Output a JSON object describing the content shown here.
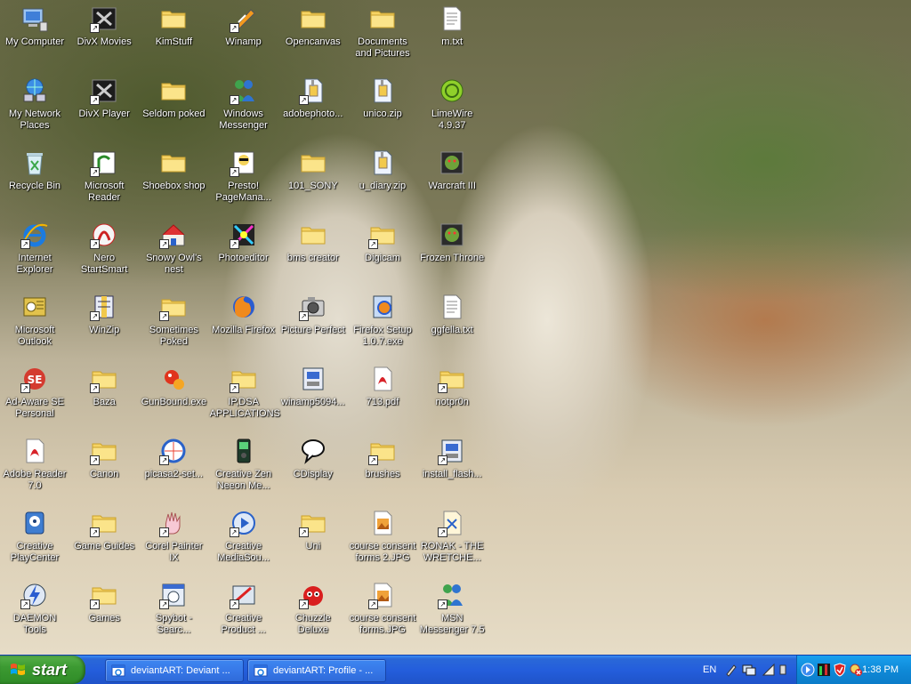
{
  "desktop": {
    "icons": [
      {
        "label": "My Computer",
        "icon": "computer-icon"
      },
      {
        "label": "DivX Movies",
        "icon": "divx-icon"
      },
      {
        "label": "KimStuff",
        "icon": "folder-icon"
      },
      {
        "label": "Winamp",
        "icon": "winamp-icon"
      },
      {
        "label": "Opencanvas",
        "icon": "folder-icon"
      },
      {
        "label": "Documents and Pictures",
        "icon": "folder-icon"
      },
      {
        "label": "m.txt",
        "icon": "text-file-icon"
      },
      {
        "label": "My Network Places",
        "icon": "network-icon"
      },
      {
        "label": "DivX Player",
        "icon": "divx-icon"
      },
      {
        "label": "Seldom poked",
        "icon": "folder-icon"
      },
      {
        "label": "Windows Messenger",
        "icon": "messenger-icon"
      },
      {
        "label": "adobephoto...",
        "icon": "zip-icon"
      },
      {
        "label": "unico.zip",
        "icon": "zip-icon"
      },
      {
        "label": "LimeWire 4.9.37",
        "icon": "limewire-icon"
      },
      {
        "label": "Recycle Bin",
        "icon": "recycle-bin-icon"
      },
      {
        "label": "Microsoft Reader",
        "icon": "reader-icon"
      },
      {
        "label": "Shoebox shop",
        "icon": "folder-icon"
      },
      {
        "label": "Presto! PageMana...",
        "icon": "presto-icon"
      },
      {
        "label": "101_SONY",
        "icon": "folder-icon"
      },
      {
        "label": "u_diary.zip",
        "icon": "zip-icon"
      },
      {
        "label": "Warcraft III",
        "icon": "warcraft-icon"
      },
      {
        "label": "Internet Explorer",
        "icon": "internet-explorer-icon"
      },
      {
        "label": "Nero StartSmart",
        "icon": "nero-icon"
      },
      {
        "label": "Snowy Owl's nest",
        "icon": "house-icon"
      },
      {
        "label": "Photoeditor",
        "icon": "photoeditor-icon"
      },
      {
        "label": "bms creator",
        "icon": "folder-icon"
      },
      {
        "label": "Digicam",
        "icon": "folder-icon"
      },
      {
        "label": "Frozen Throne",
        "icon": "warcraft-icon"
      },
      {
        "label": "Microsoft Outlook",
        "icon": "outlook-icon"
      },
      {
        "label": "WinZip",
        "icon": "winzip-icon"
      },
      {
        "label": "Sometimes Poked",
        "icon": "folder-icon"
      },
      {
        "label": "Mozilla Firefox",
        "icon": "firefox-icon"
      },
      {
        "label": "Picture Perfect",
        "icon": "camera-icon"
      },
      {
        "label": "Firefox Setup 1.0.7.exe",
        "icon": "setup-icon"
      },
      {
        "label": "ggfella.txt",
        "icon": "text-file-icon"
      },
      {
        "label": "Ad-Aware SE Personal",
        "icon": "adaware-icon"
      },
      {
        "label": "Baza",
        "icon": "folder-icon"
      },
      {
        "label": "GunBound.exe",
        "icon": "gunbound-icon"
      },
      {
        "label": "IP,DSA APPLICATIONS",
        "icon": "folder-icon"
      },
      {
        "label": "winamp5094...",
        "icon": "installer-icon"
      },
      {
        "label": "713.pdf",
        "icon": "pdf-icon"
      },
      {
        "label": "notpr0n",
        "icon": "folder-icon"
      },
      {
        "label": "Adobe Reader 7.0",
        "icon": "pdf-icon"
      },
      {
        "label": "Canon",
        "icon": "folder-icon"
      },
      {
        "label": "picasa2-set...",
        "icon": "picasa-icon"
      },
      {
        "label": "Creative Zen Neeon Me...",
        "icon": "mp3-player-icon"
      },
      {
        "label": "CDisplay",
        "icon": "speech-bubble-icon"
      },
      {
        "label": "brushes",
        "icon": "folder-icon"
      },
      {
        "label": "install_flash...",
        "icon": "installer-icon"
      },
      {
        "label": "Creative PlayCenter",
        "icon": "playcenter-icon"
      },
      {
        "label": "Game Guides",
        "icon": "folder-icon"
      },
      {
        "label": "Corel Painter IX",
        "icon": "hand-icon"
      },
      {
        "label": "Creative MediaSou...",
        "icon": "media-icon"
      },
      {
        "label": "Uni",
        "icon": "folder-icon"
      },
      {
        "label": "course consent forms 2.JPG",
        "icon": "image-file-icon"
      },
      {
        "label": "RONAK - THE WRETCHE...",
        "icon": "document-icon"
      },
      {
        "label": "DAEMON Tools",
        "icon": "daemon-icon"
      },
      {
        "label": "Games",
        "icon": "folder-icon"
      },
      {
        "label": "Spybot - Searc...",
        "icon": "spybot-icon"
      },
      {
        "label": "Creative Product ...",
        "icon": "creative-icon"
      },
      {
        "label": "Chuzzle Deluxe",
        "icon": "chuzzle-icon"
      },
      {
        "label": "course consent forms.JPG",
        "icon": "image-file-icon"
      },
      {
        "label": "MSN Messenger 7.5",
        "icon": "messenger-icon"
      }
    ]
  },
  "taskbar": {
    "start_label": "start",
    "tasks": [
      {
        "label": "deviantART: Deviant ...",
        "icon": "ie-window-icon"
      },
      {
        "label": "deviantART: Profile - ...",
        "icon": "ie-window-icon"
      }
    ],
    "language": "EN",
    "clock": "1:38 PM"
  }
}
